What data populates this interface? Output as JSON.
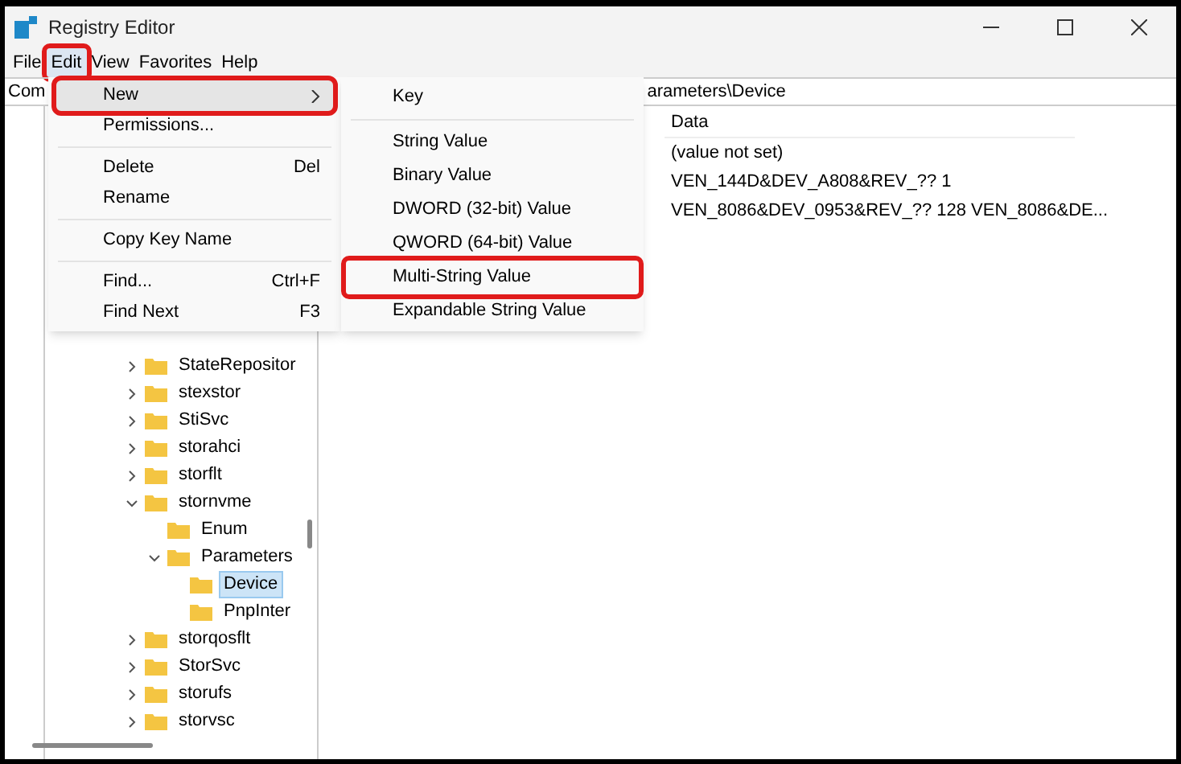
{
  "window": {
    "title": "Registry Editor"
  },
  "menu_bar": [
    {
      "label": "File",
      "selected": false,
      "highlighted": false
    },
    {
      "label": "Edit",
      "selected": true,
      "highlighted": true
    },
    {
      "label": "View",
      "selected": false,
      "highlighted": false
    },
    {
      "label": "Favorites",
      "selected": false,
      "highlighted": false
    },
    {
      "label": "Help",
      "selected": false,
      "highlighted": false
    }
  ],
  "address_bar": {
    "left_text": "Com",
    "right_text": "arameters\\Device"
  },
  "edit_menu": [
    {
      "kind": "item",
      "label": "New",
      "submenu": true,
      "selected": true,
      "highlighted": true
    },
    {
      "kind": "item",
      "label": "Permissions...",
      "selected": false,
      "highlighted": false
    },
    {
      "kind": "separator"
    },
    {
      "kind": "item",
      "label": "Delete",
      "shortcut": "Del",
      "selected": false,
      "highlighted": false
    },
    {
      "kind": "item",
      "label": "Rename",
      "selected": false,
      "highlighted": false
    },
    {
      "kind": "separator"
    },
    {
      "kind": "item",
      "label": "Copy Key Name",
      "selected": false,
      "highlighted": false
    },
    {
      "kind": "separator"
    },
    {
      "kind": "item",
      "label": "Find...",
      "shortcut": "Ctrl+F",
      "selected": false,
      "highlighted": false
    },
    {
      "kind": "item",
      "label": "Find Next",
      "shortcut": "F3",
      "selected": false,
      "highlighted": false
    }
  ],
  "new_submenu": [
    {
      "kind": "item",
      "label": "Key",
      "highlighted": false
    },
    {
      "kind": "separator"
    },
    {
      "kind": "item",
      "label": "String Value",
      "highlighted": false
    },
    {
      "kind": "item",
      "label": "Binary Value",
      "highlighted": false
    },
    {
      "kind": "item",
      "label": "DWORD (32-bit) Value",
      "highlighted": false
    },
    {
      "kind": "item",
      "label": "QWORD (64-bit) Value",
      "highlighted": false
    },
    {
      "kind": "item",
      "label": "Multi-String Value",
      "highlighted": true
    },
    {
      "kind": "item",
      "label": "Expandable String Value",
      "highlighted": false
    }
  ],
  "tree": [
    {
      "name": "StateRepositor",
      "expanded": false,
      "selected": false
    },
    {
      "name": "stexstor",
      "expanded": false,
      "selected": false
    },
    {
      "name": "StiSvc",
      "expanded": false,
      "selected": false
    },
    {
      "name": "storahci",
      "expanded": false,
      "selected": false
    },
    {
      "name": "storflt",
      "expanded": false,
      "selected": false
    },
    {
      "name": "stornvme",
      "expanded": true,
      "selected": false,
      "children": [
        {
          "name": "Enum",
          "selected": false
        },
        {
          "name": "Parameters",
          "expanded": true,
          "selected": false,
          "children": [
            {
              "name": "Device",
              "selected": true
            },
            {
              "name": "PnpInter",
              "selected": false
            }
          ]
        }
      ]
    },
    {
      "name": "storqosflt",
      "expanded": false,
      "selected": false
    },
    {
      "name": "StorSvc",
      "expanded": false,
      "selected": false
    },
    {
      "name": "storufs",
      "expanded": false,
      "selected": false
    },
    {
      "name": "storvsc",
      "expanded": false,
      "selected": false
    }
  ],
  "values_table": {
    "columns": [
      "Data"
    ],
    "rows": [
      "(value not set)",
      "VEN_144D&DEV_A808&REV_?? 1",
      "VEN_8086&DEV_0953&REV_?? 128 VEN_8086&DE..."
    ]
  }
}
